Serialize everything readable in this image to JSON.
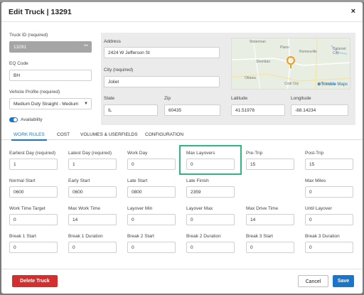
{
  "window": {
    "title": "Edit Truck | 13291",
    "close_glyph": "×"
  },
  "fields": {
    "truck_id": {
      "label": "Truck ID (required)",
      "value": "13291"
    },
    "eq_code": {
      "label": "EQ Code",
      "value": "BH"
    },
    "vehicle_profile": {
      "label": "Vehicle Profile (required)",
      "value": "Medium Duty Straight - Medium"
    },
    "availability": {
      "label": "Availability",
      "checked": true
    },
    "address": {
      "label": "Address",
      "value": "2424 W Jefferson St"
    },
    "city": {
      "label": "City (required)",
      "value": "Joliet"
    },
    "state": {
      "label": "State",
      "value": "IL"
    },
    "zip": {
      "label": "Zip",
      "value": "60435"
    },
    "latitude": {
      "label": "Latitude",
      "value": "41.51976"
    },
    "longitude": {
      "label": "Longitude",
      "value": "-88.14234"
    }
  },
  "map": {
    "place_labels": [
      "Waterman",
      "Plano",
      "Romeoville",
      "Calumet City",
      "Sheridan",
      "Ottawa",
      "Coal City"
    ],
    "attribution_brand": "Trimble",
    "attribution_suffix": "Maps"
  },
  "tabs": [
    "WORK RULES",
    "COST",
    "VOLUMES & USERFIELDS",
    "CONFIGURATION"
  ],
  "active_tab": "WORK RULES",
  "work_rules": [
    {
      "label": "Earliest Day (required)",
      "value": "1"
    },
    {
      "label": "Latest Day (required)",
      "value": "1"
    },
    {
      "label": "Work Day",
      "value": "0"
    },
    {
      "label": "Max Layovers",
      "value": "0"
    },
    {
      "label": "Pre-Trip",
      "value": "15"
    },
    {
      "label": "Post-Trip",
      "value": "15"
    },
    {
      "label": "Normal Start",
      "value": "0600"
    },
    {
      "label": "Early Start",
      "value": "0600"
    },
    {
      "label": "Late Start",
      "value": "0800"
    },
    {
      "label": "Late Finish",
      "value": "2359"
    },
    {
      "label": "Max Miles",
      "value": "0"
    },
    {
      "label": "Work Time Target",
      "value": "0"
    },
    {
      "label": "Max Work Time",
      "value": "14"
    },
    {
      "label": "Layover Min",
      "value": "0"
    },
    {
      "label": "Layover Max",
      "value": "0"
    },
    {
      "label": "Max Drive Time",
      "value": "14"
    },
    {
      "label": "Until Layover",
      "value": "0"
    },
    {
      "label": "Break 1 Start",
      "value": "0"
    },
    {
      "label": "Break 1 Duration",
      "value": "0"
    },
    {
      "label": "Break 2 Start",
      "value": "0"
    },
    {
      "label": "Break 2 Duration",
      "value": "0"
    },
    {
      "label": "Break 3 Start",
      "value": "0"
    },
    {
      "label": "Break 3 Duration",
      "value": "0"
    }
  ],
  "buttons": {
    "delete": "Delete Truck",
    "cancel": "Cancel",
    "save": "Save"
  },
  "colors": {
    "primary": "#1b75c9",
    "danger": "#d32f2f",
    "highlight": "#2fb57e",
    "marker": "#f39a1e"
  }
}
